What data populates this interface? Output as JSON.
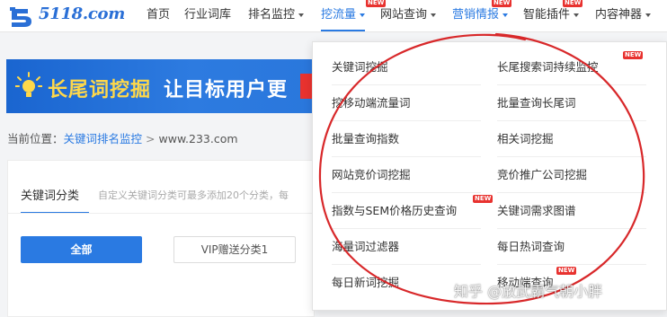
{
  "brand": {
    "logo_text": "5118.com",
    "logo_color": "#2a6fd6"
  },
  "nav": {
    "items": [
      {
        "label": "首页"
      },
      {
        "label": "行业词库"
      },
      {
        "label": "排名监控",
        "has_caret": true
      },
      {
        "label": "挖流量",
        "has_caret": true,
        "badge": "NEW",
        "active": true
      },
      {
        "label": "网站查询",
        "has_caret": true
      },
      {
        "label": "营销情报",
        "has_caret": true,
        "badge": "NEW",
        "highlighted": true
      },
      {
        "label": "智能插件",
        "has_caret": true,
        "badge": "NEW"
      },
      {
        "label": "内容神器",
        "has_caret": true
      }
    ],
    "accent_color": "#2a7ae2",
    "badge_color": "#e8322f"
  },
  "banner": {
    "title": "长尾词挖掘",
    "subtitle": "让目标用户更",
    "icon": "lightbulb-icon"
  },
  "breadcrumb": {
    "prefix": "当前位置：",
    "link": "关键词排名监控",
    "separator": ">",
    "current": "www.233.com"
  },
  "panel": {
    "tab_label": "关键词分类",
    "hint": "自定义关键词分类可最多添加20个分类，每",
    "btn_all": "全部",
    "btn_vip": "VIP赠送分类1"
  },
  "dropdown": {
    "left_column": [
      {
        "label": "关键词挖掘"
      },
      {
        "label": "挖移动端流量词"
      },
      {
        "label": "批量查询指数"
      },
      {
        "label": "网站竞价词挖掘"
      },
      {
        "label": "指数与SEM价格历史查询",
        "badge": "NEW"
      },
      {
        "label": "海量词过滤器"
      },
      {
        "label": "每日新词挖掘"
      }
    ],
    "right_column": [
      {
        "label": "长尾搜索词持续监控",
        "badge": "NEW"
      },
      {
        "label": "批量查询长尾词"
      },
      {
        "label": "相关词挖掘"
      },
      {
        "label": "竞价推广公司挖掘"
      },
      {
        "label": "关键词需求图谱"
      },
      {
        "label": "每日热词查询"
      },
      {
        "label": "移动端查询",
        "badge": "NEW"
      }
    ]
  },
  "annotation": {
    "color": "#d8282a"
  },
  "watermark": {
    "text": "知乎 @放武霸气朝小胖"
  }
}
